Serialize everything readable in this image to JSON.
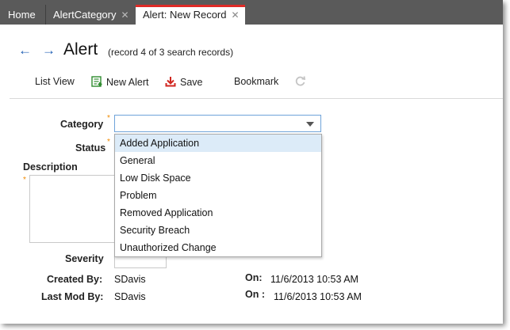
{
  "tabs": [
    {
      "label": "Home",
      "closable": false
    },
    {
      "label": "AlertCategory",
      "closable": true
    },
    {
      "label": "Alert: New Record",
      "closable": true,
      "active": true
    }
  ],
  "tab_close_glyph": "✕",
  "header": {
    "back_icon": "back-arrow-icon",
    "forward_icon": "forward-arrow-icon",
    "title": "Alert",
    "subtitle": "(record 4 of 3 search records)"
  },
  "toolbar": {
    "list_view": "List View",
    "new_alert": "New Alert",
    "save": "Save",
    "bookmark": "Bookmark",
    "refresh_icon": "refresh-icon"
  },
  "form": {
    "category_label": "Category",
    "category_value": "",
    "status_label": "Status",
    "description_label": "Description",
    "severity_label": "Severity",
    "created_by_label": "Created By:",
    "created_by_value": "SDavis",
    "created_on_label": "On:",
    "created_on_value": "11/6/2013 10:53 AM",
    "last_mod_by_label": "Last Mod By:",
    "last_mod_by_value": "SDavis",
    "last_mod_on_label": "On :",
    "last_mod_on_value": "11/6/2013 10:53 AM",
    "required_marker": "*"
  },
  "category_options": [
    "Added Application",
    "General",
    "Low Disk Space",
    "Problem",
    "Removed Application",
    "Security Breach",
    "Unauthorized Change"
  ],
  "highlighted_option": "Added Application",
  "colors": {
    "tabbar": "#5a5a5a",
    "active_tab_accent": "#e02b27",
    "nav_arrow": "#1f5fb4",
    "required": "#f08a00",
    "option_highlight": "#dcebf8"
  }
}
